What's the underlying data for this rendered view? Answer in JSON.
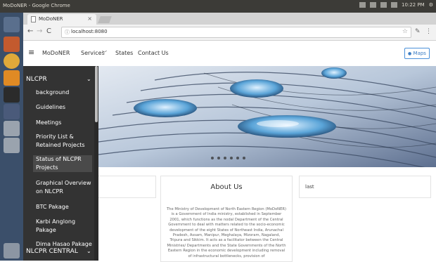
{
  "os": {
    "window_title": "MoDoNER - Google Chrome",
    "clock": "10:22 PM"
  },
  "browser": {
    "tab_title": "MoDoNER",
    "tab_close": "×",
    "url": "localhost:8080",
    "info_icon": "ⓘ"
  },
  "nav": {
    "brand": "MoDoNER",
    "menu_icon": "≡",
    "links": [
      "Services",
      "States",
      "Contact Us"
    ],
    "services_caret": "﹀",
    "maps_label": "Maps",
    "maps_icon": "●"
  },
  "sidebar": {
    "header": "NLCPR",
    "header_chevron": "⌄",
    "items": [
      "background",
      "Guidelines",
      "Meetings",
      "Priority List & Retained Projects",
      "Status of NLCPR Projects",
      "Graphical Overview on NLCPR",
      "BTC Pakage",
      "Karbi Anglong Pakage",
      "Dima Hasao Pakage"
    ],
    "active_index": 4,
    "footer": "NLCPR CENTRAL",
    "footer_chevron": "⌄"
  },
  "carousel": {
    "slide_count": 6,
    "active_index": 0
  },
  "content": {
    "about_title": "About Us",
    "about_text": "The Ministry of Development of North Eastern Region (MoDoNER) is a Government of India ministry, established in September 2001, which functions as the nodal Department of the Central Government to deal with matters related to the socio-economic development of the eight States of Northeast India, Arunachal Pradesh, Assam, Manipur, Meghalaya, Mizoram, Nagaland, Tripura and Sikkim. It acts as a facilitator between the Central Ministries/ Departments and the State Governments of the North Eastern Region in the economic development including removal of infrastructural bottlenecks, provision of",
    "right_card_text": "last"
  },
  "colors": {
    "sidebar_bg": "#333333",
    "accent_blue": "#3b7dc4",
    "launcher_bg": "#3b4f6a"
  }
}
